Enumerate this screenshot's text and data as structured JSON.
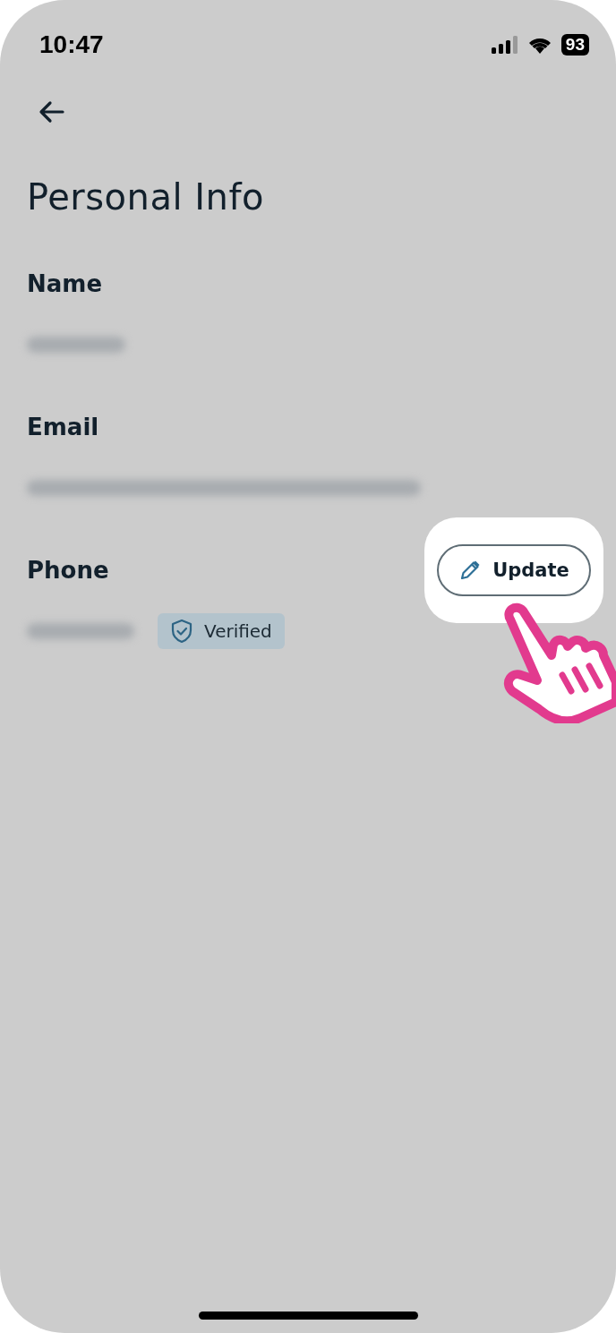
{
  "status_bar": {
    "time": "10:47",
    "battery": "93"
  },
  "title": "Personal Info",
  "fields": [
    {
      "label": "Name",
      "blurred": true
    },
    {
      "label": "Email",
      "blurred": true
    },
    {
      "label": "Phone",
      "blurred": true,
      "badge": "Verified",
      "action": "Update",
      "highlighted": true
    }
  ]
}
